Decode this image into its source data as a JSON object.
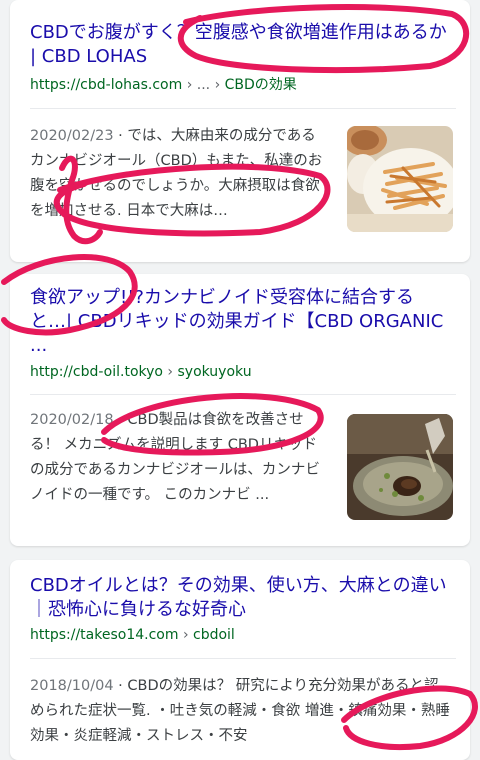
{
  "results": [
    {
      "title": "CBDでお腹がすく？空腹感や食欲増進作用はあるか | CBD LOHAS",
      "url_host": "https://cbd-lohas.com",
      "url_sep": " › ... › ",
      "url_path": "CBDの効果",
      "date": "2020/02/23",
      "snippet": " · では、大麻由来の成分であるカンナビジオール（CBD）もまた、私達のお腹を空かせるのでしょうか。大麻摂取は食欲を増加させる. 日本で大麻は…",
      "thumbnail_icon": "fried-snack-plate-photo"
    },
    {
      "title": "食欲アップ!!?カンナビノイド受容体に結合すると…| CBDリキッドの効果ガイド【CBD ORGANIC ...",
      "url_host": "http://cbd-oil.tokyo",
      "url_sep": " › ",
      "url_path": "syokuyoku",
      "date": "2020/02/18",
      "snippet": " · CBD製品は食欲を改善させる！ メカニズムを説明します CBDリキッドの成分であるカンナビジオールは、カンナビノイドの一種です。 このカンナビ ...",
      "thumbnail_icon": "herbal-bowl-photo"
    },
    {
      "title": "CBDオイルとは？その効果、使い方、大麻との違い｜恐怖心に負けるな好奇心",
      "url_host": "https://takeso14.com",
      "url_sep": " › ",
      "url_path": "cbdoil",
      "date": "2018/10/04",
      "snippet": " · CBDの効果は？ 研究により充分効果があると認められた症状一覧. ・吐き気の軽減・食欲 増進・鎮痛効果・熟睡効果・炎症軽減・ストレス・不安"
    }
  ],
  "colors": {
    "title": "#1a0dab",
    "url": "#006621",
    "annotation": "#e6195a"
  }
}
